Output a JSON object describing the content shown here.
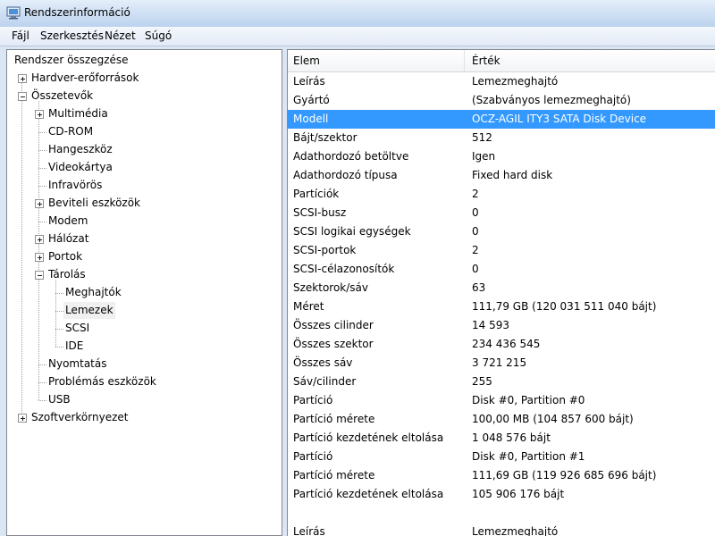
{
  "window": {
    "title": "Rendszerinformáció",
    "icon": "system-info-icon"
  },
  "menu": [
    "Fájl",
    "Szerkesztés",
    "Nézet",
    "Súgó"
  ],
  "tree": [
    {
      "label": "Rendszer összegzése",
      "level": 0,
      "expander": "none"
    },
    {
      "label": "Hardver-erőforrások",
      "level": 1,
      "expander": "plus"
    },
    {
      "label": "Összetevők",
      "level": 1,
      "expander": "minus"
    },
    {
      "label": "Multimédia",
      "level": 2,
      "expander": "plus"
    },
    {
      "label": "CD-ROM",
      "level": 2,
      "expander": "none"
    },
    {
      "label": "Hangeszköz",
      "level": 2,
      "expander": "none"
    },
    {
      "label": "Videokártya",
      "level": 2,
      "expander": "none"
    },
    {
      "label": "Infravörös",
      "level": 2,
      "expander": "none"
    },
    {
      "label": "Beviteli eszközök",
      "level": 2,
      "expander": "plus"
    },
    {
      "label": "Modem",
      "level": 2,
      "expander": "none"
    },
    {
      "label": "Hálózat",
      "level": 2,
      "expander": "plus"
    },
    {
      "label": "Portok",
      "level": 2,
      "expander": "plus"
    },
    {
      "label": "Tárolás",
      "level": 2,
      "expander": "minus"
    },
    {
      "label": "Meghajtók",
      "level": 3,
      "expander": "none"
    },
    {
      "label": "Lemezek",
      "level": 3,
      "expander": "none",
      "selected": true
    },
    {
      "label": "SCSI",
      "level": 3,
      "expander": "none"
    },
    {
      "label": "IDE",
      "level": 3,
      "expander": "none"
    },
    {
      "label": "Nyomtatás",
      "level": 2,
      "expander": "none"
    },
    {
      "label": "Problémás eszközök",
      "level": 2,
      "expander": "none"
    },
    {
      "label": "USB",
      "level": 2,
      "expander": "none"
    },
    {
      "label": "Szoftverkörnyezet",
      "level": 1,
      "expander": "plus"
    }
  ],
  "list": {
    "headers": {
      "element": "Elem",
      "value": "Érték"
    },
    "rows": [
      {
        "element": "Leírás",
        "value": "Lemezmeghajtó"
      },
      {
        "element": "Gyártó",
        "value": "(Szabványos lemezmeghajtó)"
      },
      {
        "element": "Modell",
        "value": "OCZ-AGIL ITY3 SATA Disk Device",
        "selected": true
      },
      {
        "element": "Bájt/szektor",
        "value": "512"
      },
      {
        "element": "Adathordozó betöltve",
        "value": "Igen"
      },
      {
        "element": "Adathordozó típusa",
        "value": "Fixed hard disk"
      },
      {
        "element": "Partíciók",
        "value": "2"
      },
      {
        "element": "SCSI-busz",
        "value": "0"
      },
      {
        "element": "SCSI logikai egységek",
        "value": "0"
      },
      {
        "element": "SCSI-portok",
        "value": "2"
      },
      {
        "element": "SCSI-célazonosítók",
        "value": "0"
      },
      {
        "element": "Szektorok/sáv",
        "value": "63"
      },
      {
        "element": "Méret",
        "value": "111,79 GB (120 031 511 040 bájt)"
      },
      {
        "element": "Összes cilinder",
        "value": "14 593"
      },
      {
        "element": "Összes szektor",
        "value": "234 436 545"
      },
      {
        "element": "Összes sáv",
        "value": "3 721 215"
      },
      {
        "element": "Sáv/cilinder",
        "value": "255"
      },
      {
        "element": "Partíció",
        "value": "Disk #0, Partition #0"
      },
      {
        "element": "Partíció mérete",
        "value": "100,00 MB (104 857 600 bájt)"
      },
      {
        "element": "Partíció kezdetének eltolása",
        "value": "1 048 576 bájt"
      },
      {
        "element": "Partíció",
        "value": "Disk #0, Partition #1"
      },
      {
        "element": "Partíció mérete",
        "value": "111,69 GB (119 926 685 696 bájt)"
      },
      {
        "element": "Partíció kezdetének eltolása",
        "value": "105 906 176 bájt"
      },
      {
        "element": "",
        "value": ""
      },
      {
        "element": "Leírás",
        "value": "Lemezmeghajtó"
      }
    ]
  },
  "colors": {
    "selection": "#3399ff",
    "frame": "#dbe6f4"
  }
}
